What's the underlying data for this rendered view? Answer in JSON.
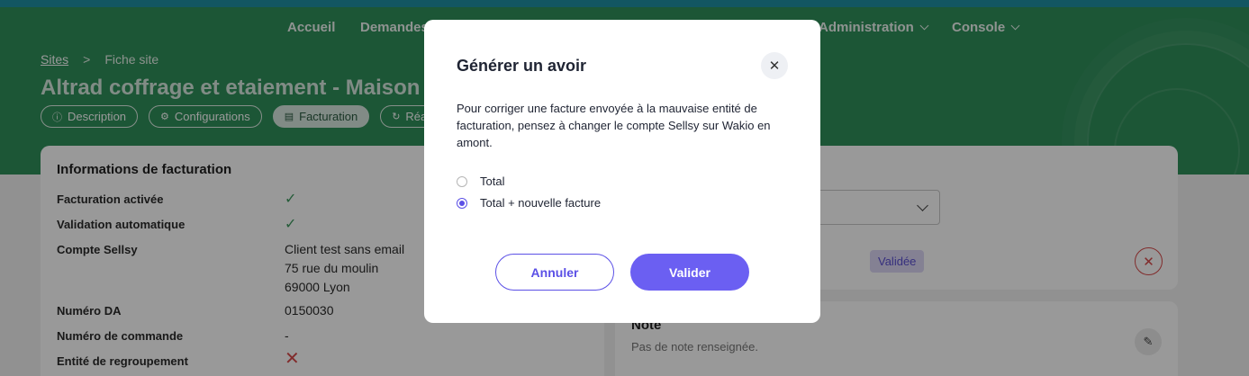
{
  "nav": {
    "items": [
      {
        "label": "Accueil",
        "has_menu": false
      },
      {
        "label": "Demandes",
        "has_menu": false
      },
      {
        "label": "Administration",
        "has_menu": true
      },
      {
        "label": "Console",
        "has_menu": true
      }
    ]
  },
  "breadcrumb": {
    "sites": "Sites",
    "separator": ">",
    "current": "Fiche site"
  },
  "page": {
    "title": "Altrad coffrage et etaiement - Maison c"
  },
  "tabs": [
    {
      "label": "Description",
      "icon": "info-icon"
    },
    {
      "label": "Configurations",
      "icon": "gear-icon"
    },
    {
      "label": "Facturation",
      "icon": "document-icon",
      "active": true
    },
    {
      "label": "Réa",
      "icon": "refresh-icon"
    }
  ],
  "billing": {
    "title": "Informations de facturation",
    "rows": {
      "enabled_label": "Facturation activée",
      "auto_label": "Validation automatique",
      "sellsy_label": "Compte Sellsy",
      "sellsy_line1": "Client test sans email",
      "sellsy_line2": "75 rue du moulin",
      "sellsy_line3": "69000 Lyon",
      "da_label": "Numéro DA",
      "da_value": "0150030",
      "order_label": "Numéro de commande",
      "order_value": "-",
      "group_label": "Entité de regroupement"
    }
  },
  "right_panel": {
    "status_badge": "Validée",
    "note_title": "Note",
    "note_empty": "Pas de note renseignée."
  },
  "modal": {
    "title": "Générer un avoir",
    "text": "Pour corriger une facture envoyée à la mauvaise entité de facturation, pensez à changer le compte Sellsy sur Wakio en amont.",
    "option_total": "Total",
    "option_total_new": "Total + nouvelle facture",
    "selected_option": "Total + nouvelle facture",
    "cancel_label": "Annuler",
    "confirm_label": "Valider"
  },
  "colors": {
    "header_green": "#2f8f5a",
    "top_strip": "#1e8fa3",
    "accent_purple": "#6b5ff2",
    "danger_red": "#d84a4a",
    "check_green": "#3e9a5f"
  }
}
